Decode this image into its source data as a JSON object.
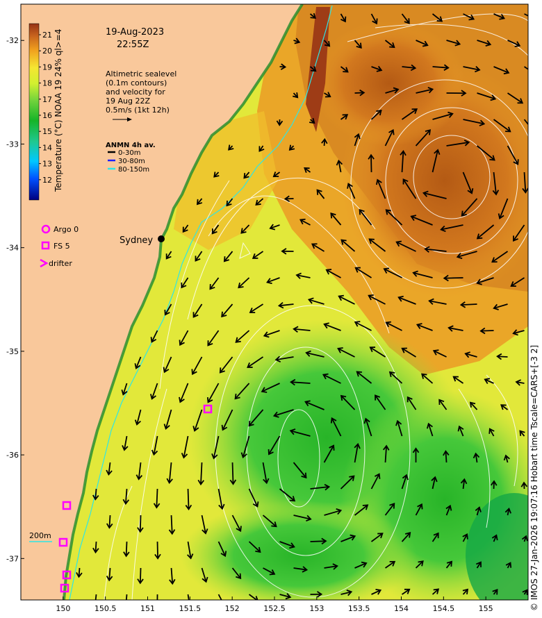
{
  "header": {
    "date": "19-Aug-2023",
    "time": "22:55Z"
  },
  "note": {
    "lines": [
      "Altimetric sealevel",
      "(0.1m contours)",
      "and velocity for",
      "19 Aug 22Z",
      "0.5m/s (1kt 12h)"
    ]
  },
  "anmn": {
    "title": "ANMN 4h av.",
    "items": [
      {
        "label": "0-30m",
        "color": "#000000"
      },
      {
        "label": "30-80m",
        "color": "#1f1fff"
      },
      {
        "label": "80-150m",
        "color": "#2ee6e6"
      }
    ]
  },
  "colorbar": {
    "label": "Temperature (°C) NOAA 19 24% ql>=4",
    "ticks": [
      "21",
      "20",
      "19",
      "18",
      "17",
      "16",
      "15",
      "14",
      "13",
      "12"
    ],
    "stops": [
      "#00007f",
      "#0050ff",
      "#00c8ff",
      "#20c890",
      "#16b428",
      "#6ed23c",
      "#d2f030",
      "#f5e632",
      "#f0a01e",
      "#c8641e",
      "#963214"
    ]
  },
  "legend": {
    "argo": "Argo 0",
    "fs": "FS 5",
    "drifter": "drifter",
    "marker_color": "#ff00ff"
  },
  "city": "Sydney",
  "isobath": "200m",
  "credit": "© IMOS 27-Jan-2026 19:07:16 Hobart time Tscale=CARS+[-3 2]",
  "axes": {
    "x_ticks": [
      "150",
      "150.5",
      "151",
      "151.5",
      "152",
      "152.5",
      "153",
      "153.5",
      "154",
      "154.5",
      "155"
    ],
    "y_ticks": [
      "-32",
      "-33",
      "-34",
      "-35",
      "-36",
      "-37"
    ],
    "xlim": [
      149.5,
      155.5
    ],
    "ylim": [
      -37.4,
      -31.65
    ]
  },
  "colors": {
    "land": "#f9c89b",
    "warm": "#c8641e",
    "mid": "#f0b428",
    "cool": "#3cc83c",
    "coast_line": "#2ee6e6"
  }
}
